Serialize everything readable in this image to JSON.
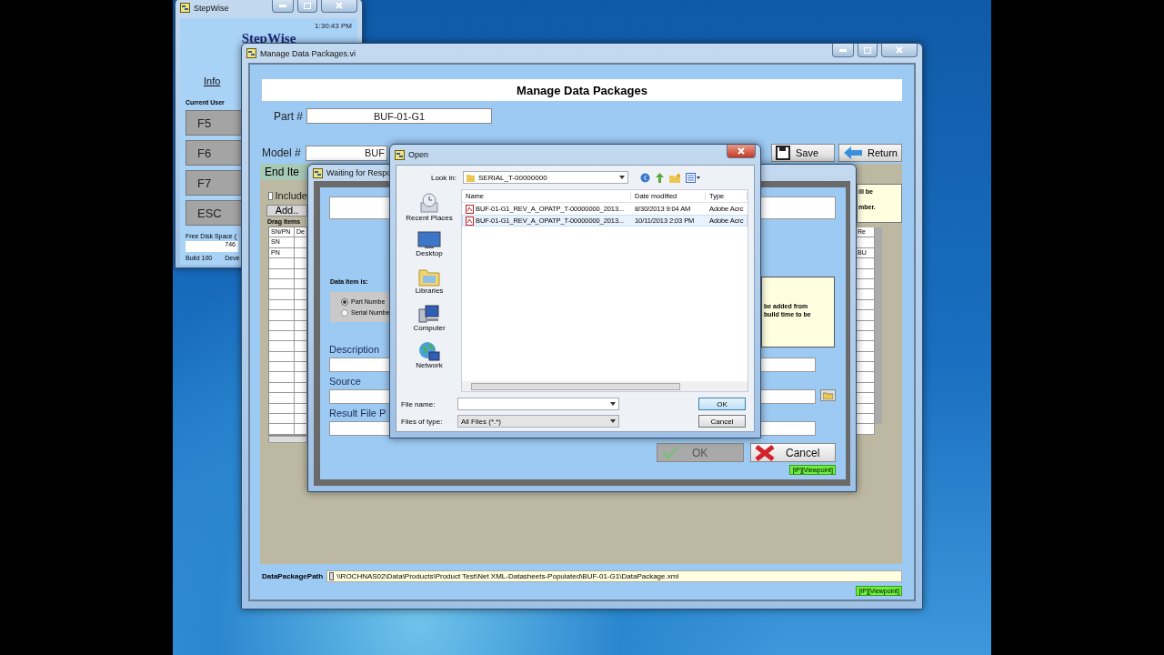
{
  "stepwise_window": {
    "title": "StepWise",
    "time": "1:30:43 PM",
    "logo": "StepWise",
    "info_link": "Info",
    "current_user_label": "Current User",
    "function_keys": [
      "F5",
      "F6",
      "F7",
      "ESC"
    ],
    "free_disk_label": "Free Disk Space (",
    "free_disk_value": "746",
    "build": "Build 100",
    "status": "Deve"
  },
  "manage_window": {
    "title": "Manage Data Packages.vi",
    "heading": "Manage Data Packages",
    "part_label": "Part #",
    "part_value": "BUF-01-G1",
    "model_label": "Model #",
    "model_value": "BUF",
    "buttons": [
      {
        "label": "Save",
        "kind": "save"
      },
      {
        "label": "Return",
        "kind": "return"
      }
    ],
    "tab": "End Ite",
    "include": {
      "label": "Include",
      "checked": false
    },
    "add_button": "Add..",
    "drag_hint": "Drag items",
    "table": {
      "columns": [
        "SN/PN",
        "De"
      ],
      "rows": [
        "SN",
        "PN"
      ]
    },
    "right_note": [
      "ill be",
      "mber."
    ],
    "right_table": {
      "column": "Re",
      "cell": "BU"
    },
    "data_package_path_label": "DataPackagePath",
    "data_package_path": "\\\\ROCHNAS02\\Data\\Products\\Product Test\\Net XML-Datasheets-Populated\\BUF-01-G1\\DataPackage.xml",
    "badge": "[IP][Viewpoint]"
  },
  "waiting_dialog": {
    "title": "Waiting for Respo",
    "data_item_label": "Data Item is:",
    "data_item_options": [
      {
        "label": "Part Numbe",
        "selected": true
      },
      {
        "label": "Serial Numbe",
        "selected": false
      }
    ],
    "note_lines": [
      "be added from",
      "build time to be"
    ],
    "description_label": "Description",
    "source_label": "Source",
    "result_label": "Result File P",
    "buttons": [
      {
        "label": "OK",
        "kind": "ok",
        "disabled": true
      },
      {
        "label": "Cancel",
        "kind": "cancel",
        "disabled": false
      }
    ],
    "badge": "[IP][Viewpoint]"
  },
  "open_dialog": {
    "title": "Open",
    "look_in_label": "Look in:",
    "look_in_value": "SERIAL_T-00000000",
    "places": [
      {
        "label": "Recent Places",
        "kind": "recent"
      },
      {
        "label": "Desktop",
        "kind": "desktop"
      },
      {
        "label": "Libraries",
        "kind": "libraries"
      },
      {
        "label": "Computer",
        "kind": "computer"
      },
      {
        "label": "Network",
        "kind": "network"
      }
    ],
    "columns": [
      "Name",
      "Date modified",
      "Type"
    ],
    "files": [
      {
        "name": "BUF-01-G1_REV_A_OPATP_T-00000000_2013...",
        "date": "8/30/2013 9:04 AM",
        "type": "Adobe Acrc",
        "hovered": false
      },
      {
        "name": "BUF-01-G1_REV_A_OPATP_T-00000000_2013...",
        "date": "10/11/2013 2:03 PM",
        "type": "Adobe Acrc",
        "hovered": true
      }
    ],
    "file_name_label": "File name:",
    "files_of_type_label": "Files of type:",
    "files_of_type_value": "All Files (*.*)",
    "buttons": [
      "OK",
      "Cancel"
    ]
  }
}
